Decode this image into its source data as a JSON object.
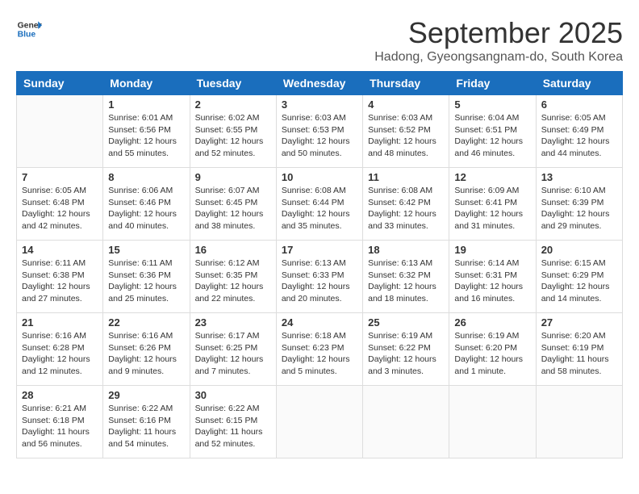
{
  "header": {
    "logo_general": "General",
    "logo_blue": "Blue",
    "month_title": "September 2025",
    "subtitle": "Hadong, Gyeongsangnam-do, South Korea"
  },
  "days_of_week": [
    "Sunday",
    "Monday",
    "Tuesday",
    "Wednesday",
    "Thursday",
    "Friday",
    "Saturday"
  ],
  "weeks": [
    [
      {
        "day": "",
        "info": ""
      },
      {
        "day": "1",
        "info": "Sunrise: 6:01 AM\nSunset: 6:56 PM\nDaylight: 12 hours\nand 55 minutes."
      },
      {
        "day": "2",
        "info": "Sunrise: 6:02 AM\nSunset: 6:55 PM\nDaylight: 12 hours\nand 52 minutes."
      },
      {
        "day": "3",
        "info": "Sunrise: 6:03 AM\nSunset: 6:53 PM\nDaylight: 12 hours\nand 50 minutes."
      },
      {
        "day": "4",
        "info": "Sunrise: 6:03 AM\nSunset: 6:52 PM\nDaylight: 12 hours\nand 48 minutes."
      },
      {
        "day": "5",
        "info": "Sunrise: 6:04 AM\nSunset: 6:51 PM\nDaylight: 12 hours\nand 46 minutes."
      },
      {
        "day": "6",
        "info": "Sunrise: 6:05 AM\nSunset: 6:49 PM\nDaylight: 12 hours\nand 44 minutes."
      }
    ],
    [
      {
        "day": "7",
        "info": "Sunrise: 6:05 AM\nSunset: 6:48 PM\nDaylight: 12 hours\nand 42 minutes."
      },
      {
        "day": "8",
        "info": "Sunrise: 6:06 AM\nSunset: 6:46 PM\nDaylight: 12 hours\nand 40 minutes."
      },
      {
        "day": "9",
        "info": "Sunrise: 6:07 AM\nSunset: 6:45 PM\nDaylight: 12 hours\nand 38 minutes."
      },
      {
        "day": "10",
        "info": "Sunrise: 6:08 AM\nSunset: 6:44 PM\nDaylight: 12 hours\nand 35 minutes."
      },
      {
        "day": "11",
        "info": "Sunrise: 6:08 AM\nSunset: 6:42 PM\nDaylight: 12 hours\nand 33 minutes."
      },
      {
        "day": "12",
        "info": "Sunrise: 6:09 AM\nSunset: 6:41 PM\nDaylight: 12 hours\nand 31 minutes."
      },
      {
        "day": "13",
        "info": "Sunrise: 6:10 AM\nSunset: 6:39 PM\nDaylight: 12 hours\nand 29 minutes."
      }
    ],
    [
      {
        "day": "14",
        "info": "Sunrise: 6:11 AM\nSunset: 6:38 PM\nDaylight: 12 hours\nand 27 minutes."
      },
      {
        "day": "15",
        "info": "Sunrise: 6:11 AM\nSunset: 6:36 PM\nDaylight: 12 hours\nand 25 minutes."
      },
      {
        "day": "16",
        "info": "Sunrise: 6:12 AM\nSunset: 6:35 PM\nDaylight: 12 hours\nand 22 minutes."
      },
      {
        "day": "17",
        "info": "Sunrise: 6:13 AM\nSunset: 6:33 PM\nDaylight: 12 hours\nand 20 minutes."
      },
      {
        "day": "18",
        "info": "Sunrise: 6:13 AM\nSunset: 6:32 PM\nDaylight: 12 hours\nand 18 minutes."
      },
      {
        "day": "19",
        "info": "Sunrise: 6:14 AM\nSunset: 6:31 PM\nDaylight: 12 hours\nand 16 minutes."
      },
      {
        "day": "20",
        "info": "Sunrise: 6:15 AM\nSunset: 6:29 PM\nDaylight: 12 hours\nand 14 minutes."
      }
    ],
    [
      {
        "day": "21",
        "info": "Sunrise: 6:16 AM\nSunset: 6:28 PM\nDaylight: 12 hours\nand 12 minutes."
      },
      {
        "day": "22",
        "info": "Sunrise: 6:16 AM\nSunset: 6:26 PM\nDaylight: 12 hours\nand 9 minutes."
      },
      {
        "day": "23",
        "info": "Sunrise: 6:17 AM\nSunset: 6:25 PM\nDaylight: 12 hours\nand 7 minutes."
      },
      {
        "day": "24",
        "info": "Sunrise: 6:18 AM\nSunset: 6:23 PM\nDaylight: 12 hours\nand 5 minutes."
      },
      {
        "day": "25",
        "info": "Sunrise: 6:19 AM\nSunset: 6:22 PM\nDaylight: 12 hours\nand 3 minutes."
      },
      {
        "day": "26",
        "info": "Sunrise: 6:19 AM\nSunset: 6:20 PM\nDaylight: 12 hours\nand 1 minute."
      },
      {
        "day": "27",
        "info": "Sunrise: 6:20 AM\nSunset: 6:19 PM\nDaylight: 11 hours\nand 58 minutes."
      }
    ],
    [
      {
        "day": "28",
        "info": "Sunrise: 6:21 AM\nSunset: 6:18 PM\nDaylight: 11 hours\nand 56 minutes."
      },
      {
        "day": "29",
        "info": "Sunrise: 6:22 AM\nSunset: 6:16 PM\nDaylight: 11 hours\nand 54 minutes."
      },
      {
        "day": "30",
        "info": "Sunrise: 6:22 AM\nSunset: 6:15 PM\nDaylight: 11 hours\nand 52 minutes."
      },
      {
        "day": "",
        "info": ""
      },
      {
        "day": "",
        "info": ""
      },
      {
        "day": "",
        "info": ""
      },
      {
        "day": "",
        "info": ""
      }
    ]
  ]
}
